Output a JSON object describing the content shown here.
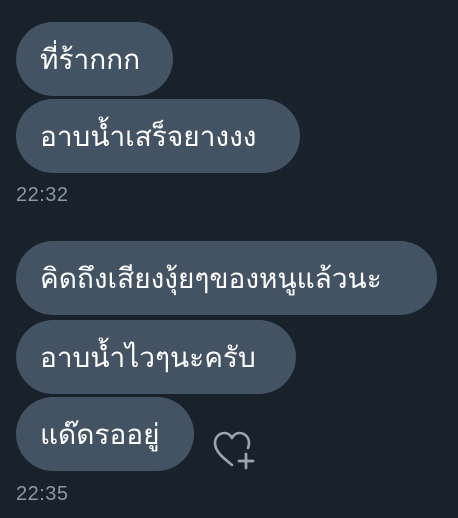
{
  "messages": [
    {
      "text": "ที่ร้ากกก"
    },
    {
      "text": "อาบน้ำเสร็จยางงง"
    },
    {
      "text": "คิดถึงเสียงงุ้ยๆของหนูแล้วนะ"
    },
    {
      "text": "อาบน้ำไวๆนะครับ"
    },
    {
      "text": "แด๊ดรออยู่"
    }
  ],
  "timestamps": [
    "22:32",
    "22:35"
  ],
  "reaction": {
    "icon": "heart-plus-icon"
  },
  "colors": {
    "background": "#19212b",
    "bubble": "#445364",
    "text": "#ffffff",
    "timestamp": "#8b98a5",
    "icon": "#9aa5b1"
  }
}
